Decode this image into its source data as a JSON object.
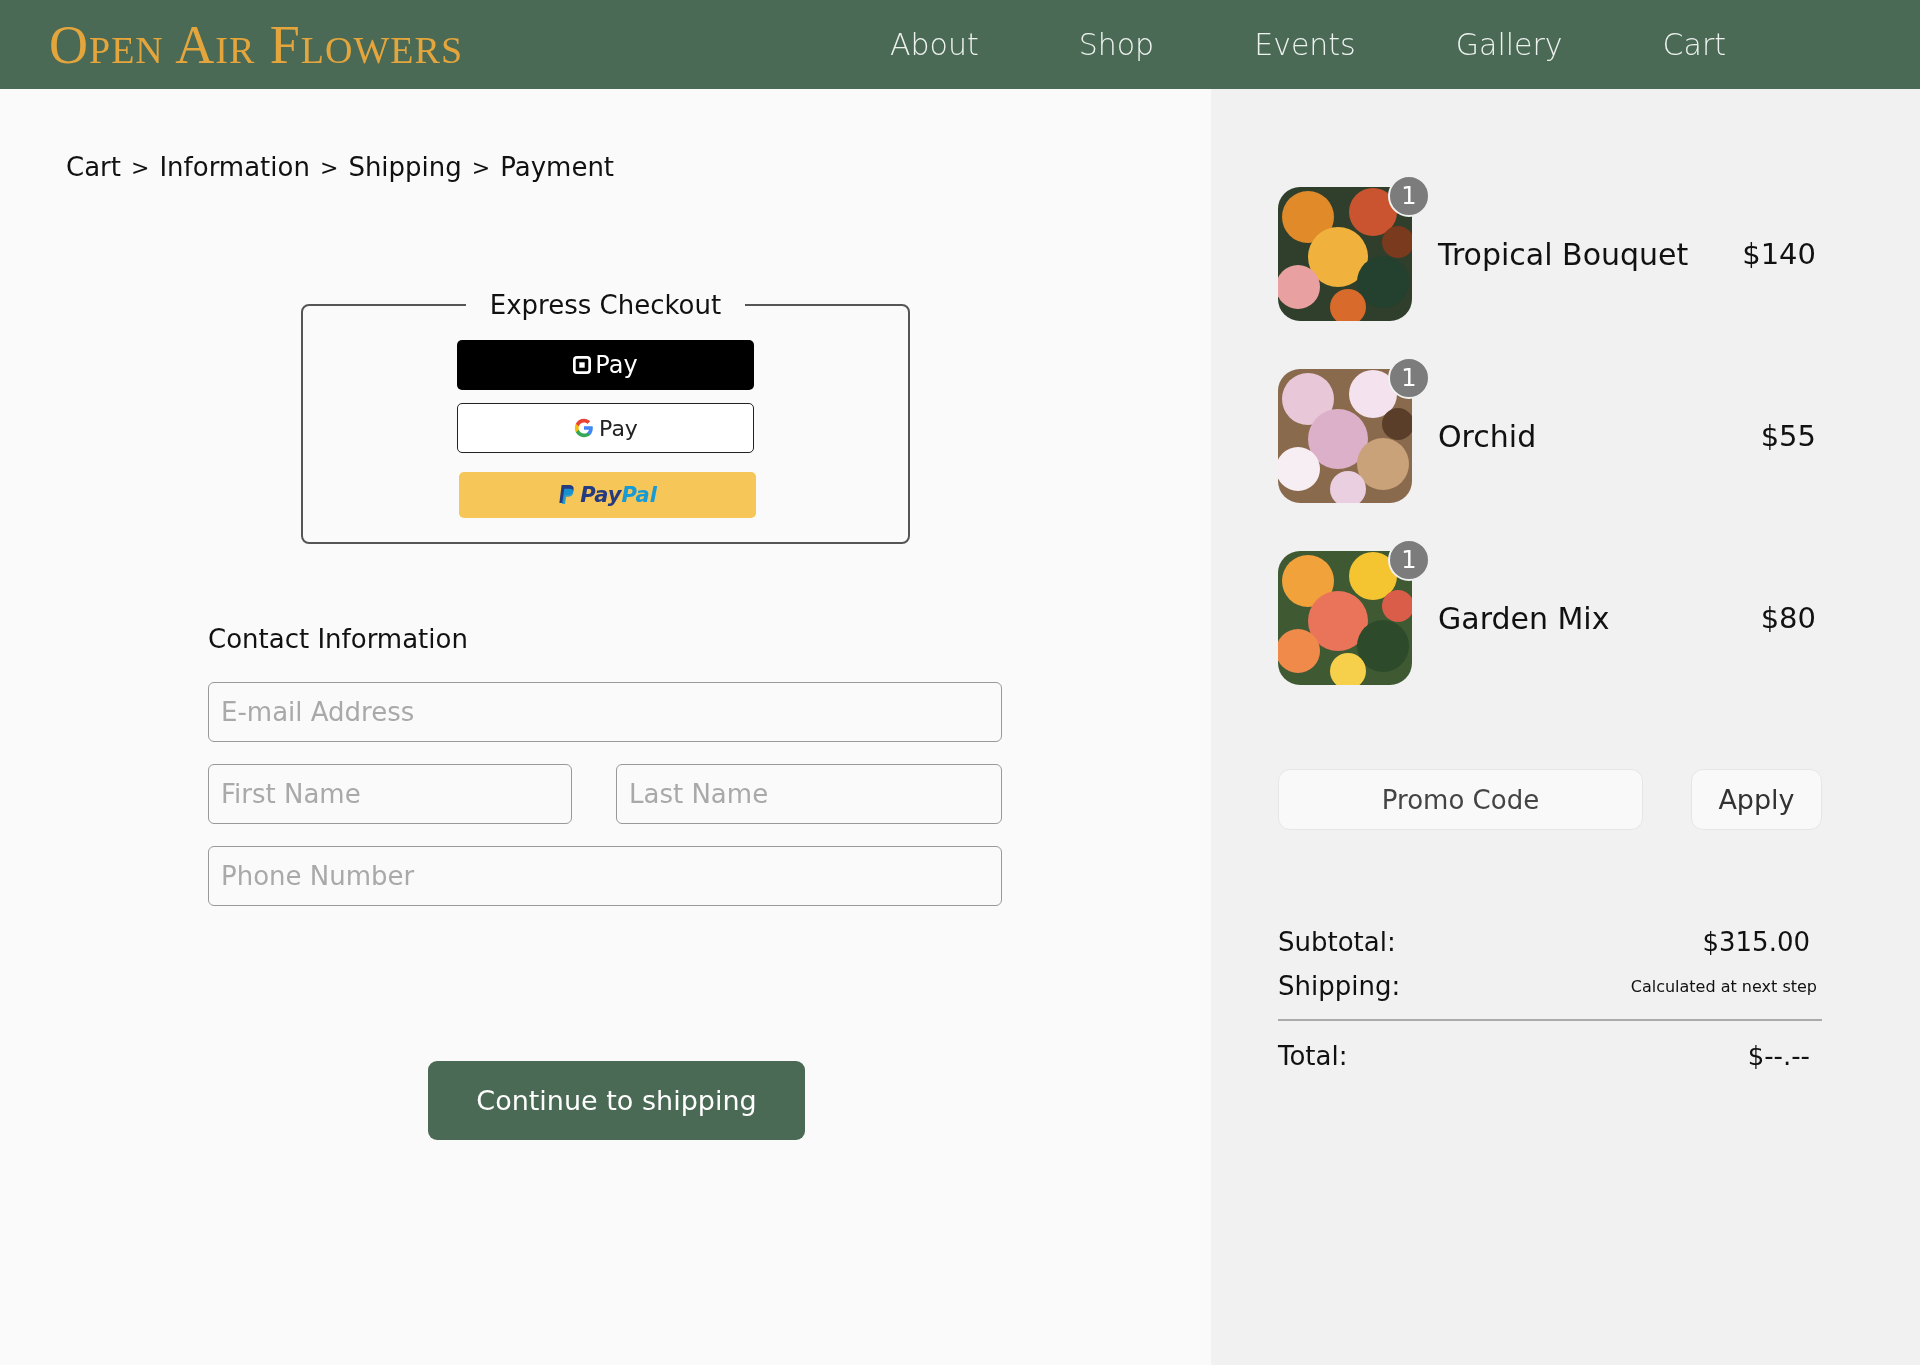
{
  "header": {
    "logo": "Open Air Flowers",
    "nav": [
      {
        "label": "About"
      },
      {
        "label": "Shop"
      },
      {
        "label": "Events"
      },
      {
        "label": "Gallery"
      },
      {
        "label": "Cart"
      }
    ]
  },
  "breadcrumb": {
    "separator": ">",
    "items": [
      {
        "label": "Cart"
      },
      {
        "label": "Information"
      },
      {
        "label": "Shipping"
      },
      {
        "label": "Payment"
      }
    ]
  },
  "express_checkout": {
    "title": "Express Checkout",
    "buttons": [
      {
        "kind": "square",
        "label": "Pay"
      },
      {
        "kind": "google",
        "label": "Pay"
      },
      {
        "kind": "paypal",
        "label_parts": [
          "Pay",
          "Pal"
        ]
      }
    ]
  },
  "contact": {
    "title": "Contact Information",
    "rows": [
      [
        {
          "placeholder": "E-mail Address"
        }
      ],
      [
        {
          "placeholder": "First Name"
        },
        {
          "placeholder": "Last Name"
        }
      ],
      [
        {
          "placeholder": "Phone Number"
        }
      ]
    ]
  },
  "continue_button": "Continue to shipping",
  "cart_items": [
    {
      "name": "Tropical Bouquet",
      "price": "$140",
      "quantity": "1"
    },
    {
      "name": "Orchid",
      "price": "$55",
      "quantity": "1"
    },
    {
      "name": "Garden Mix",
      "price": "$80",
      "quantity": "1"
    }
  ],
  "promo": {
    "placeholder": "Promo Code",
    "button": "Apply"
  },
  "summary": {
    "subtotal_label": "Subtotal:",
    "subtotal": "$315.00",
    "shipping_label": "Shipping:",
    "shipping": "Calculated at next step",
    "total_label": "Total:",
    "total": "$--.--"
  }
}
